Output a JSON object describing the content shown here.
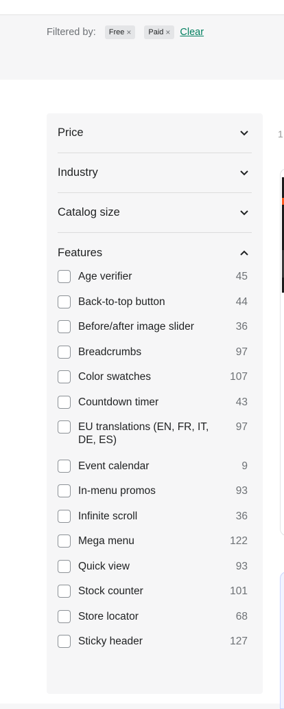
{
  "filter_bar": {
    "label": "Filtered by:",
    "chips": [
      {
        "label": "Free",
        "remove": "×"
      },
      {
        "label": "Paid",
        "remove": "×"
      }
    ],
    "clear_label": "Clear"
  },
  "sidebar": {
    "sections": [
      {
        "title": "Price",
        "expanded": false
      },
      {
        "title": "Industry",
        "expanded": false
      },
      {
        "title": "Catalog size",
        "expanded": false
      },
      {
        "title": "Features",
        "expanded": true
      }
    ],
    "features": [
      {
        "label": "Age verifier",
        "count": "45",
        "checked": false
      },
      {
        "label": "Back-to-top button",
        "count": "44",
        "checked": false
      },
      {
        "label": "Before/after image slider",
        "count": "36",
        "checked": false
      },
      {
        "label": "Breadcrumbs",
        "count": "97",
        "checked": false
      },
      {
        "label": "Color swatches",
        "count": "107",
        "checked": false
      },
      {
        "label": "Countdown timer",
        "count": "43",
        "checked": false
      },
      {
        "label": "EU translations (EN, FR, IT, DE, ES)",
        "count": "97",
        "checked": false
      },
      {
        "label": "Event calendar",
        "count": "9",
        "checked": false
      },
      {
        "label": "In-menu promos",
        "count": "93",
        "checked": false
      },
      {
        "label": "Infinite scroll",
        "count": "36",
        "checked": false
      },
      {
        "label": "Mega menu",
        "count": "122",
        "checked": false
      },
      {
        "label": "Quick view",
        "count": "93",
        "checked": false
      },
      {
        "label": "Stock counter",
        "count": "101",
        "checked": false
      },
      {
        "label": "Store locator",
        "count": "68",
        "checked": false
      },
      {
        "label": "Sticky header",
        "count": "127",
        "checked": false
      }
    ]
  },
  "right_column": {
    "partial_text": "1"
  },
  "colors": {
    "accent_link": "#007f5f",
    "chip_bg": "#e4e5e7",
    "sidebar_bg": "#f6f6f7"
  }
}
